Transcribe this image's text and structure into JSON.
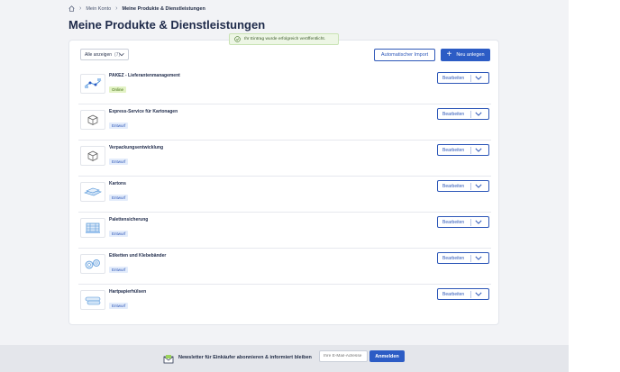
{
  "breadcrumb": {
    "items": [
      "Mein Konto",
      "Meine Produkte & Dienstleistungen"
    ]
  },
  "page": {
    "title": "Meine Produkte & Dienstleistungen"
  },
  "toast": {
    "message": "Ihr Eintrag wurde erfolgreich veröffentlicht."
  },
  "toolbar": {
    "filter_label": "Alle anzeigen",
    "filter_count": "(7)",
    "import_label": "Automatischer Import",
    "new_label": "Neu anlegen"
  },
  "products": [
    {
      "name": "PAKEZ - Lieferantenmanagement",
      "status": "Online",
      "status_type": "online",
      "thumb": "supply-chain-icon",
      "edit_label": "Bearbeiten"
    },
    {
      "name": "Express-Service für Kartonagen",
      "status": "Entwurf",
      "status_type": "draft",
      "thumb": "box-icon",
      "edit_label": "Bearbeiten"
    },
    {
      "name": "Verpackungsentwicklung",
      "status": "Entwurf",
      "status_type": "draft",
      "thumb": "box-icon",
      "edit_label": "Bearbeiten"
    },
    {
      "name": "Kartons",
      "status": "Entwurf",
      "status_type": "draft",
      "thumb": "cartons-icon",
      "edit_label": "Bearbeiten"
    },
    {
      "name": "Palettensicherung",
      "status": "Entwurf",
      "status_type": "draft",
      "thumb": "pallet-icon",
      "edit_label": "Bearbeiten"
    },
    {
      "name": "Etiketten und Klebebänder",
      "status": "Entwurf",
      "status_type": "draft",
      "thumb": "tape-icon",
      "edit_label": "Bearbeiten"
    },
    {
      "name": "Hartpapierhülsen",
      "status": "Entwurf",
      "status_type": "draft",
      "thumb": "tubes-icon",
      "edit_label": "Bearbeiten"
    }
  ],
  "newsletter": {
    "text": "Newsletter für Einkäufer abonnieren & informiert bleiben",
    "placeholder": "Ihre E-Mail-Adresse",
    "button": "Anmelden"
  },
  "colors": {
    "primary": "#2c5cc5",
    "online_bg": "#e3f3c5",
    "draft_bg": "#e3ecfb"
  }
}
